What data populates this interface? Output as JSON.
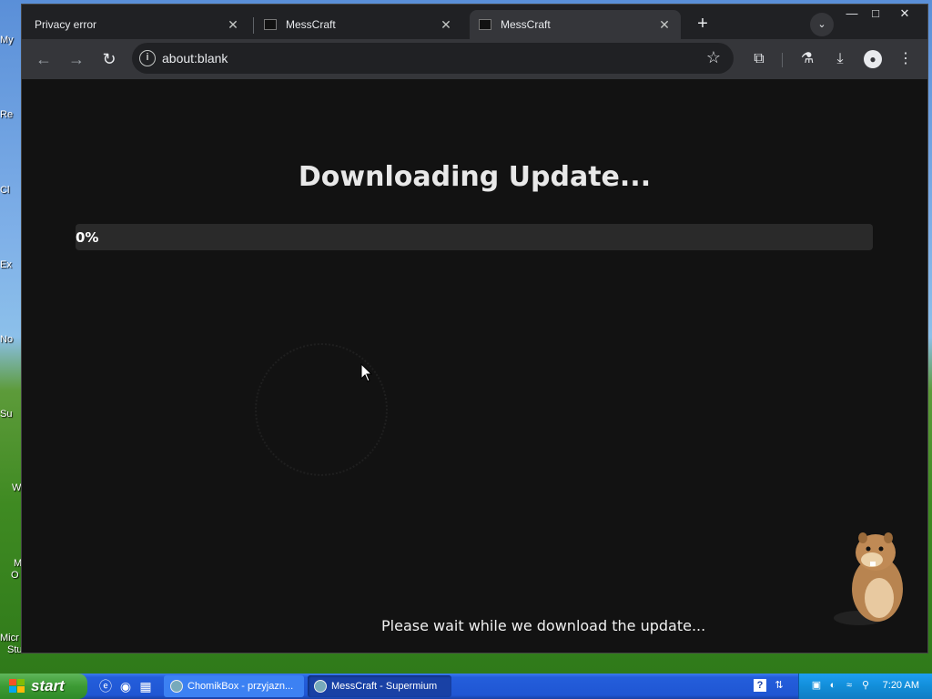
{
  "desktop": {
    "icon_labels": [
      "My",
      "Re",
      "Cl",
      "Ex",
      "No",
      "Su",
      "W",
      "M",
      "O",
      "Micr",
      "Stu"
    ]
  },
  "browser": {
    "tabs": [
      {
        "title": "Privacy error",
        "active": false
      },
      {
        "title": "MessCraft",
        "active": false
      },
      {
        "title": "MessCraft",
        "active": true
      }
    ],
    "window_controls": {
      "minimize": "—",
      "maximize": "□",
      "close": "✕"
    },
    "address_bar": {
      "url": "about:blank"
    }
  },
  "page": {
    "heading": "Downloading Update...",
    "progress": {
      "text": "0%",
      "value": 0
    },
    "status_message": "Please wait while we download the update..."
  },
  "taskbar": {
    "start_label": "start",
    "buttons": [
      {
        "label": "ChomikBox - przyjazn...",
        "active": false
      },
      {
        "label": "MessCraft - Supermium",
        "active": true
      }
    ],
    "clock": "7:20 AM"
  },
  "colors": {
    "page_bg": "#121212",
    "progress_track": "#2a2a2a",
    "progress_fill": "#4caf50",
    "browser_frame": "#202124",
    "toolbar": "#35363a"
  }
}
